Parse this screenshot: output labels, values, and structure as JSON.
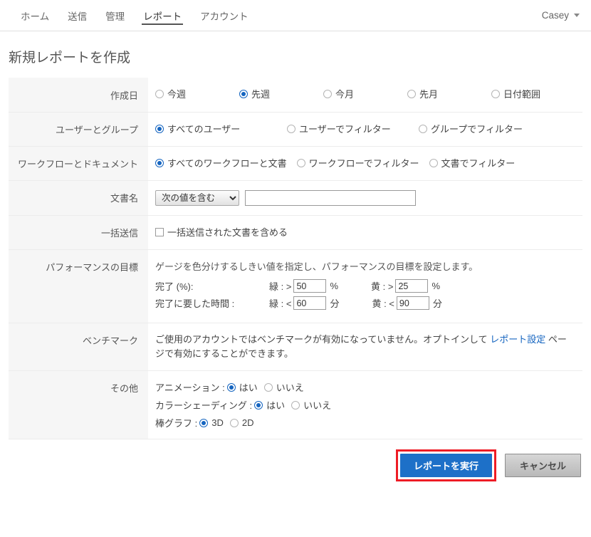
{
  "nav": {
    "items": [
      {
        "label": "ホーム",
        "active": false
      },
      {
        "label": "送信",
        "active": false
      },
      {
        "label": "管理",
        "active": false
      },
      {
        "label": "レポート",
        "active": true
      },
      {
        "label": "アカウント",
        "active": false
      }
    ],
    "user": "Casey"
  },
  "page": {
    "title": "新規レポートを作成"
  },
  "rows": {
    "creation_date": {
      "label": "作成日",
      "options": [
        {
          "label": "今週",
          "selected": false
        },
        {
          "label": "先週",
          "selected": true
        },
        {
          "label": "今月",
          "selected": false
        },
        {
          "label": "先月",
          "selected": false
        },
        {
          "label": "日付範囲",
          "selected": false
        }
      ]
    },
    "users_groups": {
      "label": "ユーザーとグループ",
      "options": [
        {
          "label": "すべてのユーザー",
          "selected": true
        },
        {
          "label": "ユーザーでフィルター",
          "selected": false
        },
        {
          "label": "グループでフィルター",
          "selected": false
        }
      ]
    },
    "workflows_documents": {
      "label": "ワークフローとドキュメント",
      "options": [
        {
          "label": "すべてのワークフローと文書",
          "selected": true
        },
        {
          "label": "ワークフローでフィルター",
          "selected": false
        },
        {
          "label": "文書でフィルター",
          "selected": false
        }
      ]
    },
    "document_name": {
      "label": "文書名",
      "select_value": "次の値を含む",
      "select_options": [
        "次の値を含む"
      ],
      "text_value": "",
      "text_placeholder": ""
    },
    "bulk_send": {
      "label": "一括送信",
      "checkbox_label": "一括送信された文書を含める",
      "checked": false
    },
    "performance": {
      "label": "パフォーマンスの目標",
      "description": "ゲージを色分けするしきい値を指定し、パフォーマンスの目標を設定します。",
      "lines": [
        {
          "name": "完了 (%):",
          "green_label": "緑 : >",
          "green_value": "50",
          "green_unit": "%",
          "yellow_label": "黄 : >",
          "yellow_value": "25",
          "yellow_unit": "%"
        },
        {
          "name": "完了に要した時間 :",
          "green_label": "緑 : <",
          "green_value": "60",
          "green_unit": "分",
          "yellow_label": "黄 : <",
          "yellow_value": "90",
          "yellow_unit": "分"
        }
      ]
    },
    "benchmark": {
      "label": "ベンチマーク",
      "text_before": "ご使用のアカウントではベンチマークが有効になっていません。オプトインして ",
      "link_text": "レポート設定",
      "text_after": " ページで有効にすることができます。"
    },
    "other": {
      "label": "その他",
      "lines": [
        {
          "name": "アニメーション :",
          "options": [
            {
              "label": "はい",
              "selected": true
            },
            {
              "label": "いいえ",
              "selected": false
            }
          ]
        },
        {
          "name": "カラーシェーディング :",
          "options": [
            {
              "label": "はい",
              "selected": true
            },
            {
              "label": "いいえ",
              "selected": false
            }
          ]
        },
        {
          "name": "棒グラフ :",
          "options": [
            {
              "label": "3D",
              "selected": true
            },
            {
              "label": "2D",
              "selected": false
            }
          ]
        }
      ]
    }
  },
  "footer": {
    "run_label": "レポートを実行",
    "cancel_label": "キャンセル"
  },
  "colors": {
    "accent": "#1565c0",
    "primary_button": "#1d70c8",
    "highlight": "#ee1c25",
    "link": "#1565c0"
  }
}
